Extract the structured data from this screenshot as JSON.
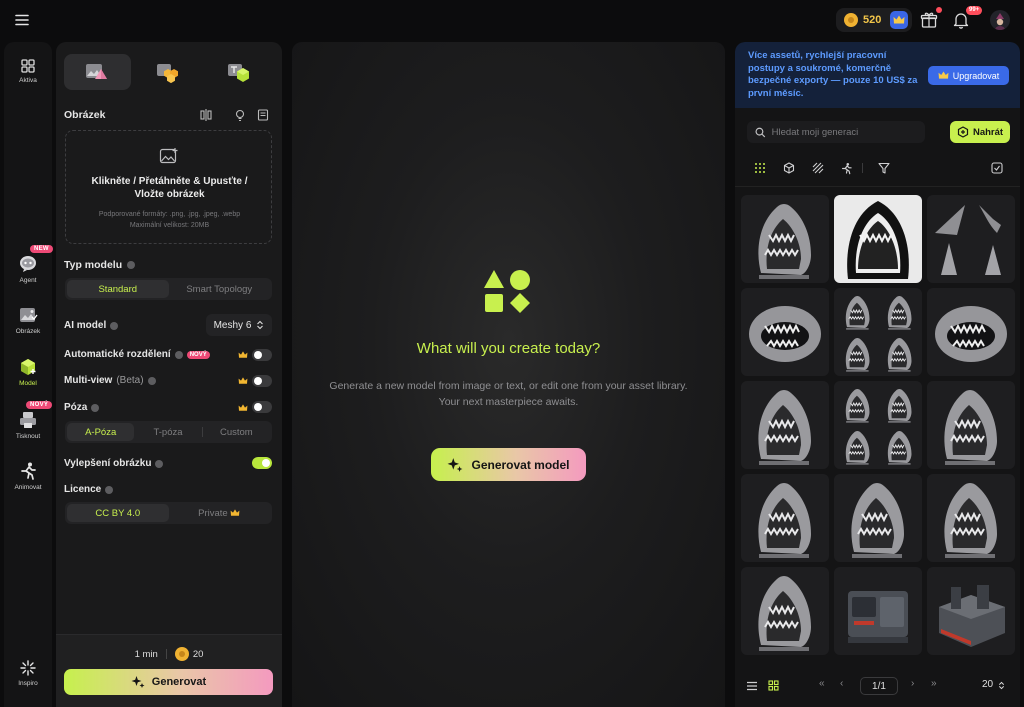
{
  "topbar": {
    "credits": "520",
    "notifications_badge": "99+"
  },
  "leftnav": {
    "items": [
      {
        "label": "Aktiva"
      },
      {
        "label": "Agent",
        "badge": "NEW"
      },
      {
        "label": "Obrázek"
      },
      {
        "label": "Model"
      },
      {
        "label": "Tisknout",
        "badge": "NOVÝ"
      },
      {
        "label": "Animovat"
      },
      {
        "label": "Inspiro"
      }
    ],
    "active": "Model"
  },
  "panel": {
    "image_section": {
      "title": "Obrázek"
    },
    "upload": {
      "main": "Klikněte / Přetáhněte & Upusťte / Vložte obrázek",
      "formats": "Podporované formáty: .png, .jpg, .jpeg, .webp",
      "max_size": "Maximální velikost: 20MB"
    },
    "model_type": {
      "label": "Typ modelu",
      "options": [
        "Standard",
        "Smart Topology"
      ],
      "selected": "Standard"
    },
    "ai_model": {
      "label": "AI model",
      "value": "Meshy 6"
    },
    "auto_split": {
      "label": "Automatické rozdělení",
      "badge": "NOVÝ",
      "enabled": false
    },
    "multiview": {
      "label": "Multi-view",
      "suffix": "(Beta)",
      "enabled": false
    },
    "pose": {
      "label": "Póza",
      "enabled": false,
      "options": [
        "A-Póza",
        "T-póza",
        "Custom"
      ],
      "selected": "A-Póza"
    },
    "image_enhance": {
      "label": "Vylepšení obrázku",
      "enabled": true
    },
    "license": {
      "label": "Licence",
      "options": [
        "CC BY 4.0",
        "Private"
      ],
      "selected": "CC BY 4.0"
    },
    "estimate": {
      "time": "1 min",
      "cost": "20"
    },
    "generate_label": "Generovat"
  },
  "center": {
    "headline": "What will you create today?",
    "subtitle": "Generate a new model from image or text, or edit one from your asset library. Your next masterpiece awaits.",
    "button_label": "Generovat model"
  },
  "right": {
    "promo": {
      "text": "Více assetů, rychlejší pracovní postupy a soukromé, komerčně bezpečné exporty — pouze 10 US$ za první měsíc.",
      "button": "Upgradovat"
    },
    "search": {
      "placeholder": "Hledat moji generaci"
    },
    "upload_label": "Nahrát",
    "assets": [
      {
        "kind": "shark-jaw"
      },
      {
        "kind": "shark-jaw-white"
      },
      {
        "kind": "shark-fins"
      },
      {
        "kind": "shark-head"
      },
      {
        "kind": "shark-jaws-set"
      },
      {
        "kind": "shark-head"
      },
      {
        "kind": "shark-jaw"
      },
      {
        "kind": "shark-jaws-set"
      },
      {
        "kind": "shark-jaw"
      },
      {
        "kind": "shark-jaw"
      },
      {
        "kind": "shark-jaw"
      },
      {
        "kind": "shark-jaw"
      },
      {
        "kind": "shark-jaw"
      },
      {
        "kind": "machine"
      },
      {
        "kind": "organizer"
      }
    ],
    "pagination": {
      "page": "1/1",
      "per_page": "20"
    }
  },
  "colors": {
    "accent": "#c8f04e",
    "promo_text": "#5d9bff",
    "upgrade_button": "#3a6ae8",
    "badge": "#ee4a76"
  }
}
